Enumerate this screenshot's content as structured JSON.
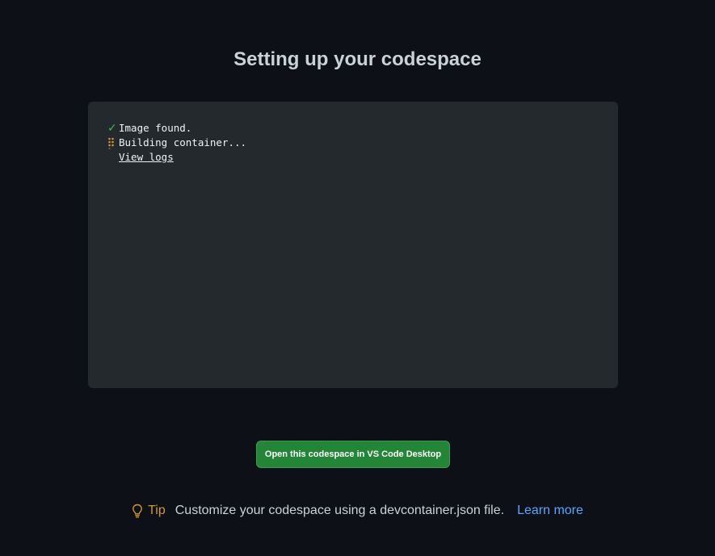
{
  "header": {
    "title": "Setting up your codespace"
  },
  "terminal": {
    "lines": [
      {
        "status": "check-icon",
        "text": "Image found."
      },
      {
        "status": "spinner-icon",
        "text": "Building container..."
      }
    ],
    "view_logs_label": "View logs"
  },
  "actions": {
    "open_desktop_label": "Open this codespace in VS Code Desktop"
  },
  "tip": {
    "label": "Tip",
    "text": "Customize your codespace using a devcontainer.json file.",
    "link_label": "Learn more"
  },
  "colors": {
    "background": "#0d1117",
    "terminal_background": "#24292e",
    "success": "#3fb950",
    "warning": "#d29922",
    "primary_button": "#238636",
    "link": "#58a6ff"
  }
}
